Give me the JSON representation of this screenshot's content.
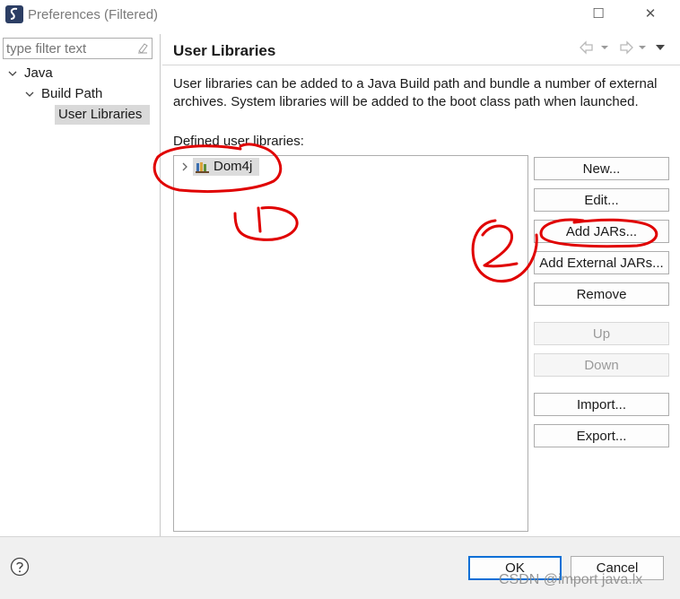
{
  "window": {
    "title": "Preferences (Filtered)",
    "controls": [
      "minimize-icon",
      "maximize-icon",
      "close-icon"
    ]
  },
  "sidebar": {
    "filter_placeholder": "type filter text",
    "tree": [
      {
        "label": "Java",
        "expanded": true,
        "level": 0
      },
      {
        "label": "Build Path",
        "expanded": true,
        "level": 1
      },
      {
        "label": "User Libraries",
        "selected": true,
        "level": 2
      }
    ]
  },
  "page": {
    "title": "User Libraries",
    "description": "User libraries can be added to a Java Build path and bundle a number of external archives. System libraries will be added to the boot class path when launched.",
    "libraries_label": "Defined user libraries:",
    "libraries": [
      {
        "name": "Dom4j",
        "icon": "library-icon",
        "selected": true
      }
    ]
  },
  "buttons": {
    "new": "New...",
    "edit": "Edit...",
    "add_jars": "Add JARs...",
    "add_external_jars": "Add External JARs...",
    "remove": "Remove",
    "up": "Up",
    "down": "Down",
    "import": "Import...",
    "export": "Export..."
  },
  "disabled_buttons": [
    "Up",
    "Down"
  ],
  "footer": {
    "ok": "OK",
    "cancel": "Cancel"
  },
  "watermark": "CSDN @import java.lx",
  "annotation_color": "#e00000",
  "accent_color": "#0a6fd6"
}
